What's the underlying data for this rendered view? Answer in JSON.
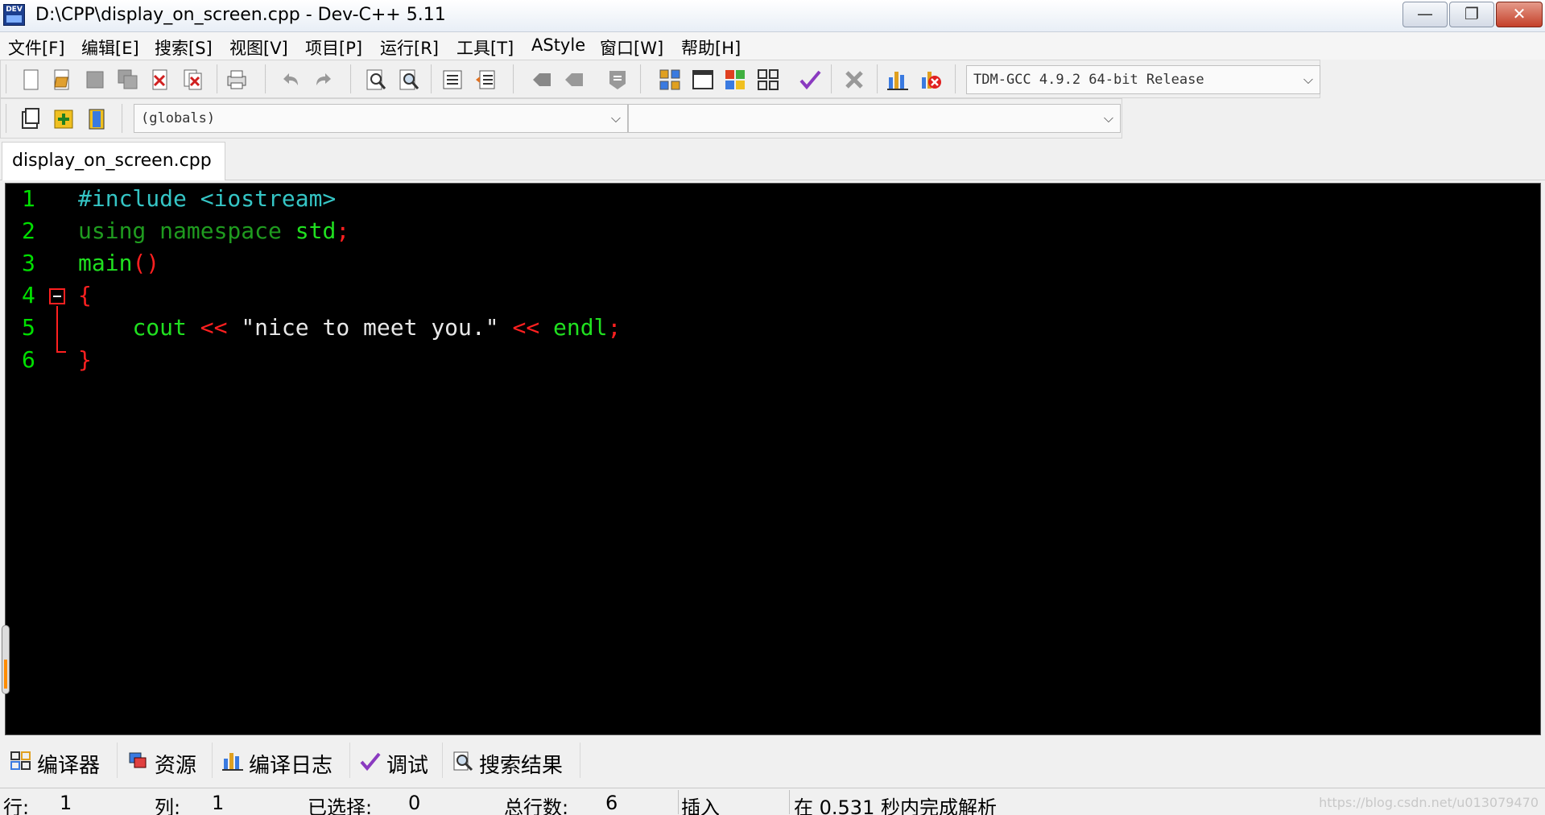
{
  "window": {
    "title": "D:\\CPP\\display_on_screen.cpp - Dev-C++ 5.11",
    "app_icon_text": "DEV",
    "minimize_glyph": "—",
    "maximize_glyph": "❐",
    "close_glyph": "✕"
  },
  "menu": {
    "items": [
      {
        "label": "文件[F]"
      },
      {
        "label": "编辑[E]"
      },
      {
        "label": "搜索[S]"
      },
      {
        "label": "视图[V]"
      },
      {
        "label": "项目[P]"
      },
      {
        "label": "运行[R]"
      },
      {
        "label": "工具[T]"
      },
      {
        "label": "AStyle"
      },
      {
        "label": "窗口[W]"
      },
      {
        "label": "帮助[H]"
      }
    ]
  },
  "toolbar": {
    "compiler_select": "TDM-GCC 4.9.2 64-bit Release",
    "scope_select": "(globals)",
    "symbol_select": "",
    "dropdown_arrow": "⌵"
  },
  "editor": {
    "file_tab": "display_on_screen.cpp",
    "line_numbers": [
      "1",
      "2",
      "3",
      "4",
      "5",
      "6"
    ],
    "code": {
      "l1_pre": "#include <iostream>",
      "l2_kw": "using namespace",
      "l2_id": "std",
      "l2_semi": ";",
      "l3_id": "main",
      "l3_parens": "()",
      "l4_brace": "{",
      "l5_indent": "    ",
      "l5_cout": "cout",
      "l5_op1": " << ",
      "l5_str": "\"nice to meet you.\"",
      "l5_op2": " << ",
      "l5_endl": "endl",
      "l5_semi": ";",
      "l6_brace": "}"
    }
  },
  "bottom_tabs": [
    {
      "label": "编译器",
      "icon": "grid-icon"
    },
    {
      "label": "资源",
      "icon": "resources-icon"
    },
    {
      "label": "编译日志",
      "icon": "bar-chart-icon"
    },
    {
      "label": "调试",
      "icon": "check-icon"
    },
    {
      "label": "搜索结果",
      "icon": "magnifier-icon"
    }
  ],
  "status": {
    "line_label": "行:",
    "line_value": "1",
    "col_label": "列:",
    "col_value": "1",
    "selected_label": "已选择:",
    "selected_value": "0",
    "total_label": "总行数:",
    "total_value": "6",
    "insert_mode": "插入",
    "parse_message": "在 0.531 秒内完成解析",
    "watermark": "https://blog.csdn.net/u013079470"
  },
  "colors": {
    "editor_bg": "#000000",
    "preprocessor": "#35c5c5",
    "keyword": "#1f9b1f",
    "identifier": "#20e020",
    "symbol": "#ff2020",
    "string": "#e8e8e8"
  }
}
